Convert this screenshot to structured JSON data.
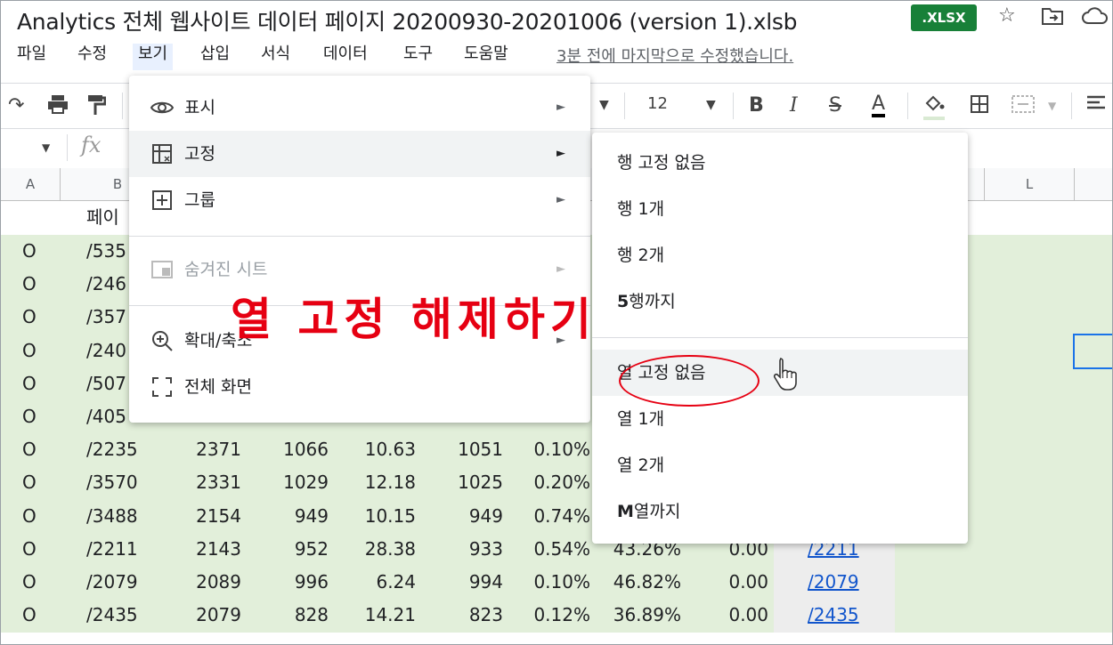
{
  "window": {
    "title": "Analytics 전체 웹사이트 데이터 페이지 20200930-20201006 (version 1).xlsb",
    "badge": ".XLSX"
  },
  "menubar": {
    "items": [
      "파일",
      "수정",
      "보기",
      "삽입",
      "서식",
      "데이터",
      "도구",
      "도움말"
    ],
    "active": "보기",
    "last_edit": "3분 전에 마지막으로 수정했습니다."
  },
  "toolbar": {
    "font_size": "12",
    "icons": [
      "redo-icon",
      "print-icon",
      "paint-format-icon",
      "bold-icon",
      "italic-icon",
      "strikethrough-icon",
      "text-color-icon",
      "fill-color-icon",
      "borders-icon",
      "merge-icon",
      "align-icon"
    ],
    "bold": "B",
    "italic": "I",
    "strike": "S",
    "text_color": "A"
  },
  "formula_bar": {
    "fx": "fx"
  },
  "columns": {
    "headers": [
      "A",
      "B",
      "L"
    ]
  },
  "header_row": {
    "b": "페이"
  },
  "rows": [
    {
      "a": "O",
      "b": "/535",
      "c": "",
      "d": "",
      "e": "",
      "f": "",
      "g": "",
      "h": "",
      "i": "",
      "j": ""
    },
    {
      "a": "O",
      "b": "/246",
      "c": "",
      "d": "",
      "e": "",
      "f": "",
      "g": "",
      "h": "",
      "i": "",
      "j": ""
    },
    {
      "a": "O",
      "b": "/357",
      "c": "",
      "d": "",
      "e": "",
      "f": "",
      "g": "",
      "h": "",
      "i": "",
      "j": ""
    },
    {
      "a": "O",
      "b": "/240",
      "c": "",
      "d": "",
      "e": "",
      "f": "",
      "g": "",
      "h": "",
      "i": "",
      "j": ""
    },
    {
      "a": "O",
      "b": "/507",
      "c": "",
      "d": "",
      "e": "",
      "f": "",
      "g": "",
      "h": "",
      "i": "",
      "j": ""
    },
    {
      "a": "O",
      "b": "/405",
      "c": "",
      "d": "",
      "e": "",
      "f": "",
      "g": "",
      "h": "",
      "i": "",
      "j": ""
    },
    {
      "a": "O",
      "b": "/2235",
      "c": "2371",
      "d": "1066",
      "e": "10.63",
      "f": "1051",
      "g": "0.10%",
      "h": "",
      "i": "",
      "j": ""
    },
    {
      "a": "O",
      "b": "/3570",
      "c": "2331",
      "d": "1029",
      "e": "12.18",
      "f": "1025",
      "g": "0.20%",
      "h": "",
      "i": "",
      "j": ""
    },
    {
      "a": "O",
      "b": "/3488",
      "c": "2154",
      "d": "949",
      "e": "10.15",
      "f": "949",
      "g": "0.74%",
      "h": "",
      "i": "",
      "j": ""
    },
    {
      "a": "O",
      "b": "/2211",
      "c": "2143",
      "d": "952",
      "e": "28.38",
      "f": "933",
      "g": "0.54%",
      "h": "43.26%",
      "i": "0.00",
      "j": "/2211"
    },
    {
      "a": "O",
      "b": "/2079",
      "c": "2089",
      "d": "996",
      "e": "6.24",
      "f": "994",
      "g": "0.10%",
      "h": "46.82%",
      "i": "0.00",
      "j": "/2079"
    },
    {
      "a": "O",
      "b": "/2435",
      "c": "2079",
      "d": "828",
      "e": "14.21",
      "f": "823",
      "g": "0.12%",
      "h": "36.89%",
      "i": "0.00",
      "j": "/2435"
    }
  ],
  "view_menu": {
    "items": [
      {
        "icon": "eye-icon",
        "label": "표시",
        "arrow": "►"
      },
      {
        "icon": "freeze-icon",
        "label": "고정",
        "arrow": "►"
      },
      {
        "icon": "group-icon",
        "label": "그룹",
        "arrow": "►"
      },
      {
        "icon": "hidden-sheets-icon",
        "label": "숨겨진 시트",
        "arrow": "►"
      },
      {
        "icon": "zoom-icon",
        "label": "확대/축소",
        "arrow": "►"
      },
      {
        "icon": "fullscreen-icon",
        "label": "전체 화면",
        "arrow": ""
      }
    ]
  },
  "freeze_menu": {
    "items": [
      "행 고정 없음",
      "행 1개",
      "행 2개",
      "5행까지",
      "열 고정 없음",
      "열 1개",
      "열 2개",
      "M열까지"
    ],
    "rows_upto_bold": "5",
    "rows_upto_rest": "행까지",
    "cols_upto_bold": "M",
    "cols_upto_rest": "열까지"
  },
  "annotation": {
    "text": "열 고정 해제하기"
  },
  "colors": {
    "accent": "#e60012",
    "badge": "#188038",
    "green_fill": "#e2efda"
  }
}
